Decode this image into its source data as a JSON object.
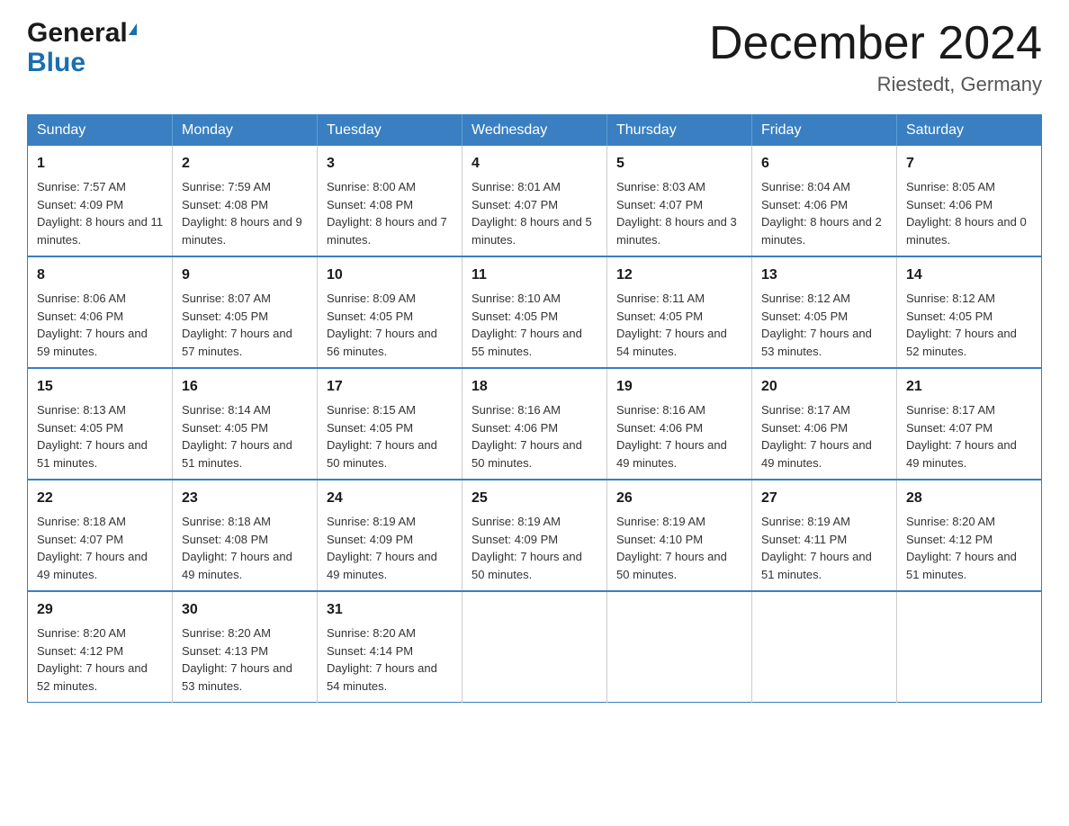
{
  "header": {
    "logo_general": "General",
    "logo_blue": "Blue",
    "month_title": "December 2024",
    "location": "Riestedt, Germany"
  },
  "days_of_week": [
    "Sunday",
    "Monday",
    "Tuesday",
    "Wednesday",
    "Thursday",
    "Friday",
    "Saturday"
  ],
  "weeks": [
    [
      {
        "day": "1",
        "sunrise": "Sunrise: 7:57 AM",
        "sunset": "Sunset: 4:09 PM",
        "daylight": "Daylight: 8 hours and 11 minutes."
      },
      {
        "day": "2",
        "sunrise": "Sunrise: 7:59 AM",
        "sunset": "Sunset: 4:08 PM",
        "daylight": "Daylight: 8 hours and 9 minutes."
      },
      {
        "day": "3",
        "sunrise": "Sunrise: 8:00 AM",
        "sunset": "Sunset: 4:08 PM",
        "daylight": "Daylight: 8 hours and 7 minutes."
      },
      {
        "day": "4",
        "sunrise": "Sunrise: 8:01 AM",
        "sunset": "Sunset: 4:07 PM",
        "daylight": "Daylight: 8 hours and 5 minutes."
      },
      {
        "day": "5",
        "sunrise": "Sunrise: 8:03 AM",
        "sunset": "Sunset: 4:07 PM",
        "daylight": "Daylight: 8 hours and 3 minutes."
      },
      {
        "day": "6",
        "sunrise": "Sunrise: 8:04 AM",
        "sunset": "Sunset: 4:06 PM",
        "daylight": "Daylight: 8 hours and 2 minutes."
      },
      {
        "day": "7",
        "sunrise": "Sunrise: 8:05 AM",
        "sunset": "Sunset: 4:06 PM",
        "daylight": "Daylight: 8 hours and 0 minutes."
      }
    ],
    [
      {
        "day": "8",
        "sunrise": "Sunrise: 8:06 AM",
        "sunset": "Sunset: 4:06 PM",
        "daylight": "Daylight: 7 hours and 59 minutes."
      },
      {
        "day": "9",
        "sunrise": "Sunrise: 8:07 AM",
        "sunset": "Sunset: 4:05 PM",
        "daylight": "Daylight: 7 hours and 57 minutes."
      },
      {
        "day": "10",
        "sunrise": "Sunrise: 8:09 AM",
        "sunset": "Sunset: 4:05 PM",
        "daylight": "Daylight: 7 hours and 56 minutes."
      },
      {
        "day": "11",
        "sunrise": "Sunrise: 8:10 AM",
        "sunset": "Sunset: 4:05 PM",
        "daylight": "Daylight: 7 hours and 55 minutes."
      },
      {
        "day": "12",
        "sunrise": "Sunrise: 8:11 AM",
        "sunset": "Sunset: 4:05 PM",
        "daylight": "Daylight: 7 hours and 54 minutes."
      },
      {
        "day": "13",
        "sunrise": "Sunrise: 8:12 AM",
        "sunset": "Sunset: 4:05 PM",
        "daylight": "Daylight: 7 hours and 53 minutes."
      },
      {
        "day": "14",
        "sunrise": "Sunrise: 8:12 AM",
        "sunset": "Sunset: 4:05 PM",
        "daylight": "Daylight: 7 hours and 52 minutes."
      }
    ],
    [
      {
        "day": "15",
        "sunrise": "Sunrise: 8:13 AM",
        "sunset": "Sunset: 4:05 PM",
        "daylight": "Daylight: 7 hours and 51 minutes."
      },
      {
        "day": "16",
        "sunrise": "Sunrise: 8:14 AM",
        "sunset": "Sunset: 4:05 PM",
        "daylight": "Daylight: 7 hours and 51 minutes."
      },
      {
        "day": "17",
        "sunrise": "Sunrise: 8:15 AM",
        "sunset": "Sunset: 4:05 PM",
        "daylight": "Daylight: 7 hours and 50 minutes."
      },
      {
        "day": "18",
        "sunrise": "Sunrise: 8:16 AM",
        "sunset": "Sunset: 4:06 PM",
        "daylight": "Daylight: 7 hours and 50 minutes."
      },
      {
        "day": "19",
        "sunrise": "Sunrise: 8:16 AM",
        "sunset": "Sunset: 4:06 PM",
        "daylight": "Daylight: 7 hours and 49 minutes."
      },
      {
        "day": "20",
        "sunrise": "Sunrise: 8:17 AM",
        "sunset": "Sunset: 4:06 PM",
        "daylight": "Daylight: 7 hours and 49 minutes."
      },
      {
        "day": "21",
        "sunrise": "Sunrise: 8:17 AM",
        "sunset": "Sunset: 4:07 PM",
        "daylight": "Daylight: 7 hours and 49 minutes."
      }
    ],
    [
      {
        "day": "22",
        "sunrise": "Sunrise: 8:18 AM",
        "sunset": "Sunset: 4:07 PM",
        "daylight": "Daylight: 7 hours and 49 minutes."
      },
      {
        "day": "23",
        "sunrise": "Sunrise: 8:18 AM",
        "sunset": "Sunset: 4:08 PM",
        "daylight": "Daylight: 7 hours and 49 minutes."
      },
      {
        "day": "24",
        "sunrise": "Sunrise: 8:19 AM",
        "sunset": "Sunset: 4:09 PM",
        "daylight": "Daylight: 7 hours and 49 minutes."
      },
      {
        "day": "25",
        "sunrise": "Sunrise: 8:19 AM",
        "sunset": "Sunset: 4:09 PM",
        "daylight": "Daylight: 7 hours and 50 minutes."
      },
      {
        "day": "26",
        "sunrise": "Sunrise: 8:19 AM",
        "sunset": "Sunset: 4:10 PM",
        "daylight": "Daylight: 7 hours and 50 minutes."
      },
      {
        "day": "27",
        "sunrise": "Sunrise: 8:19 AM",
        "sunset": "Sunset: 4:11 PM",
        "daylight": "Daylight: 7 hours and 51 minutes."
      },
      {
        "day": "28",
        "sunrise": "Sunrise: 8:20 AM",
        "sunset": "Sunset: 4:12 PM",
        "daylight": "Daylight: 7 hours and 51 minutes."
      }
    ],
    [
      {
        "day": "29",
        "sunrise": "Sunrise: 8:20 AM",
        "sunset": "Sunset: 4:12 PM",
        "daylight": "Daylight: 7 hours and 52 minutes."
      },
      {
        "day": "30",
        "sunrise": "Sunrise: 8:20 AM",
        "sunset": "Sunset: 4:13 PM",
        "daylight": "Daylight: 7 hours and 53 minutes."
      },
      {
        "day": "31",
        "sunrise": "Sunrise: 8:20 AM",
        "sunset": "Sunset: 4:14 PM",
        "daylight": "Daylight: 7 hours and 54 minutes."
      },
      null,
      null,
      null,
      null
    ]
  ]
}
